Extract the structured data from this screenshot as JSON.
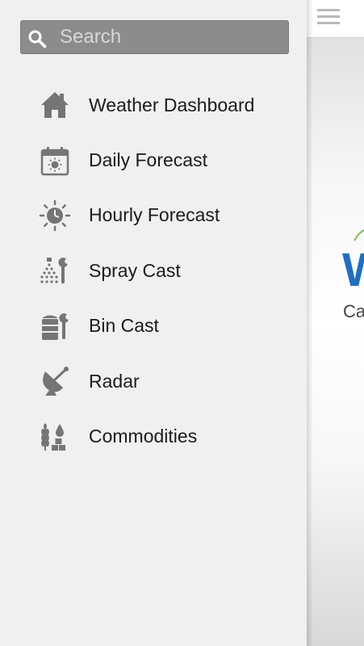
{
  "search": {
    "placeholder": "Search",
    "value": ""
  },
  "menu": {
    "items": [
      {
        "label": "Weather Dashboard",
        "icon": "home-icon"
      },
      {
        "label": "Daily Forecast",
        "icon": "calendar-sun-icon"
      },
      {
        "label": "Hourly Forecast",
        "icon": "sun-clock-icon"
      },
      {
        "label": "Spray Cast",
        "icon": "spray-wrench-icon"
      },
      {
        "label": "Bin Cast",
        "icon": "grain-bin-wrench-icon"
      },
      {
        "label": "Radar",
        "icon": "satellite-dish-icon"
      },
      {
        "label": "Commodities",
        "icon": "wheat-drop-icon"
      }
    ]
  },
  "main": {
    "logo_text": "W",
    "logo_subtext": "Ca"
  },
  "colors": {
    "drawer_background": "#eff0ef",
    "search_background": "#8c8c8c",
    "icon_gray": "#757575",
    "logo_blue": "#1f6fc1",
    "logo_green": "#7cc242",
    "hamburger_gray": "#b9b9b9"
  }
}
